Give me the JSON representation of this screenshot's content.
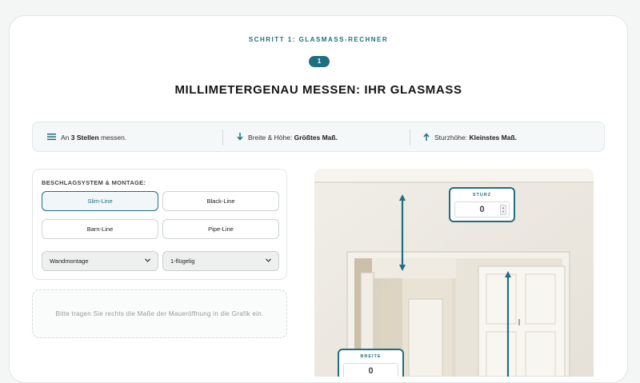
{
  "header": {
    "step_title": "SCHRITT 1: GLASMASS-RECHNER",
    "step_number": "1",
    "title": "MILLIMETERGENAU MESSEN: IHR GLASMASS"
  },
  "info_bar": {
    "items": [
      {
        "icon": "list-icon",
        "prefix": "An ",
        "bold": "3 Stellen",
        "suffix": " messen."
      },
      {
        "icon": "arrow-down-icon",
        "prefix": "Breite & Höhe: ",
        "bold": "Größtes Maß.",
        "suffix": ""
      },
      {
        "icon": "arrow-up-icon",
        "prefix": "Sturzhöhe: ",
        "bold": "Kleinstes Maß.",
        "suffix": ""
      }
    ]
  },
  "config": {
    "label": "BESCHLAGSYSTEM & MONTAGE:",
    "options": [
      "Slim-Line",
      "Black-Line",
      "Barn-Line",
      "Pipe-Line"
    ],
    "active_option": "Slim-Line",
    "mounting": "Wandmontage",
    "wings": "1-flügelig"
  },
  "hint": "Bitte tragen Sie rechts die Maße der Maueröffnung in die Grafik ein.",
  "measurements": {
    "sturz": {
      "label": "STURZ",
      "value": "0"
    },
    "breite": {
      "label": "BREITE",
      "value": "0"
    }
  },
  "colors": {
    "accent": "#1d6f80",
    "wall": "#efece6",
    "door": "#f7f5ef"
  }
}
